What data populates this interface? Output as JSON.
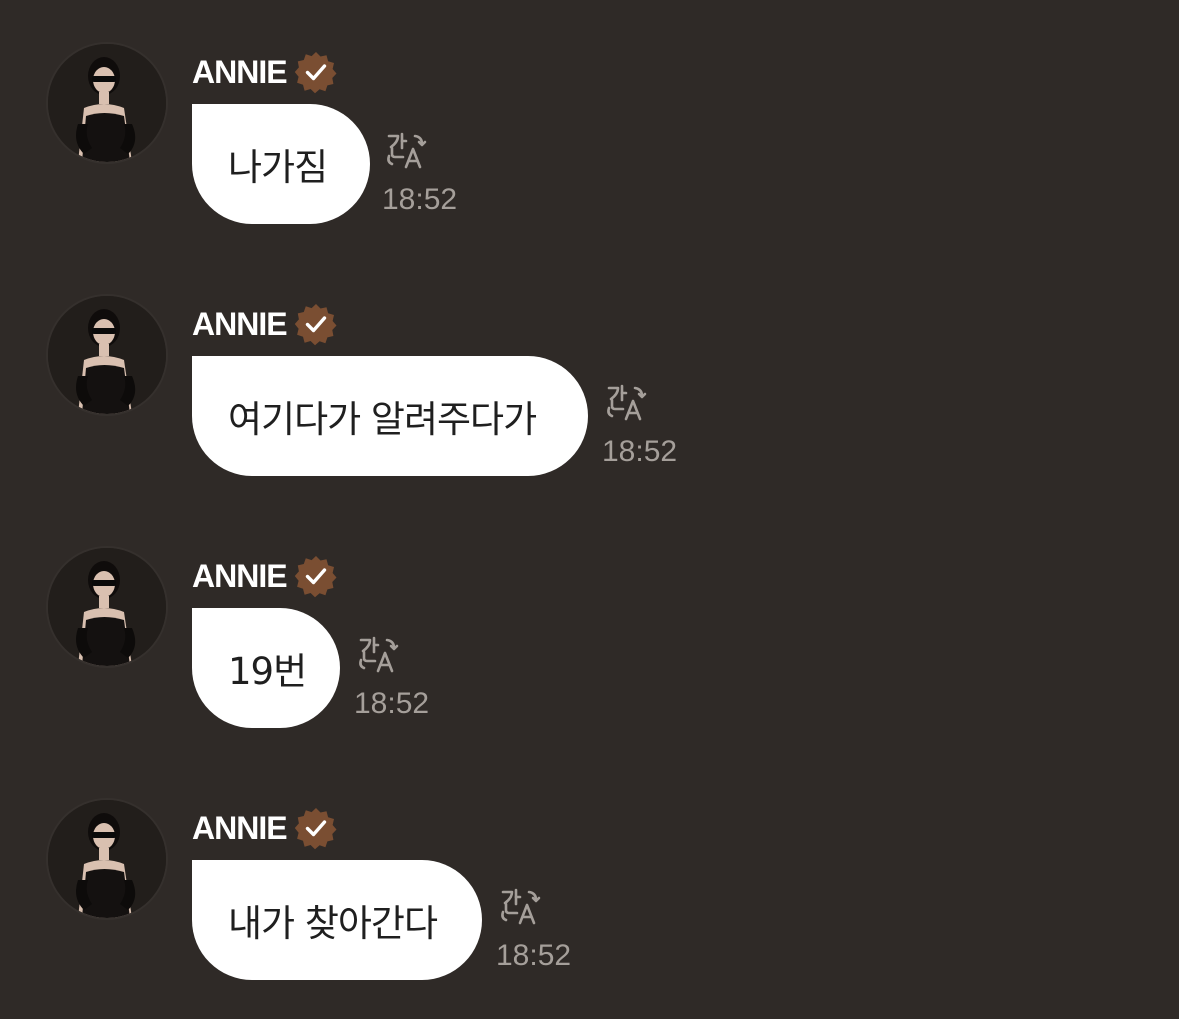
{
  "messages": [
    {
      "sender": "ANNIE",
      "text": "나가짐",
      "time": "18:52",
      "translate_icon": "translate-icon"
    },
    {
      "sender": "ANNIE",
      "text": "여기다가 알려주다가",
      "time": "18:52",
      "translate_icon": "translate-icon"
    },
    {
      "sender": "ANNIE",
      "text": "19번",
      "time": "18:52",
      "translate_icon": "translate-icon"
    },
    {
      "sender": "ANNIE",
      "text": "내가 찾아간다",
      "time": "18:52",
      "translate_icon": "translate-icon"
    }
  ],
  "colors": {
    "background": "#2f2a27",
    "bubble": "#ffffff",
    "verified_badge": "#7a4e32",
    "timestamp": "#a59f9a"
  }
}
